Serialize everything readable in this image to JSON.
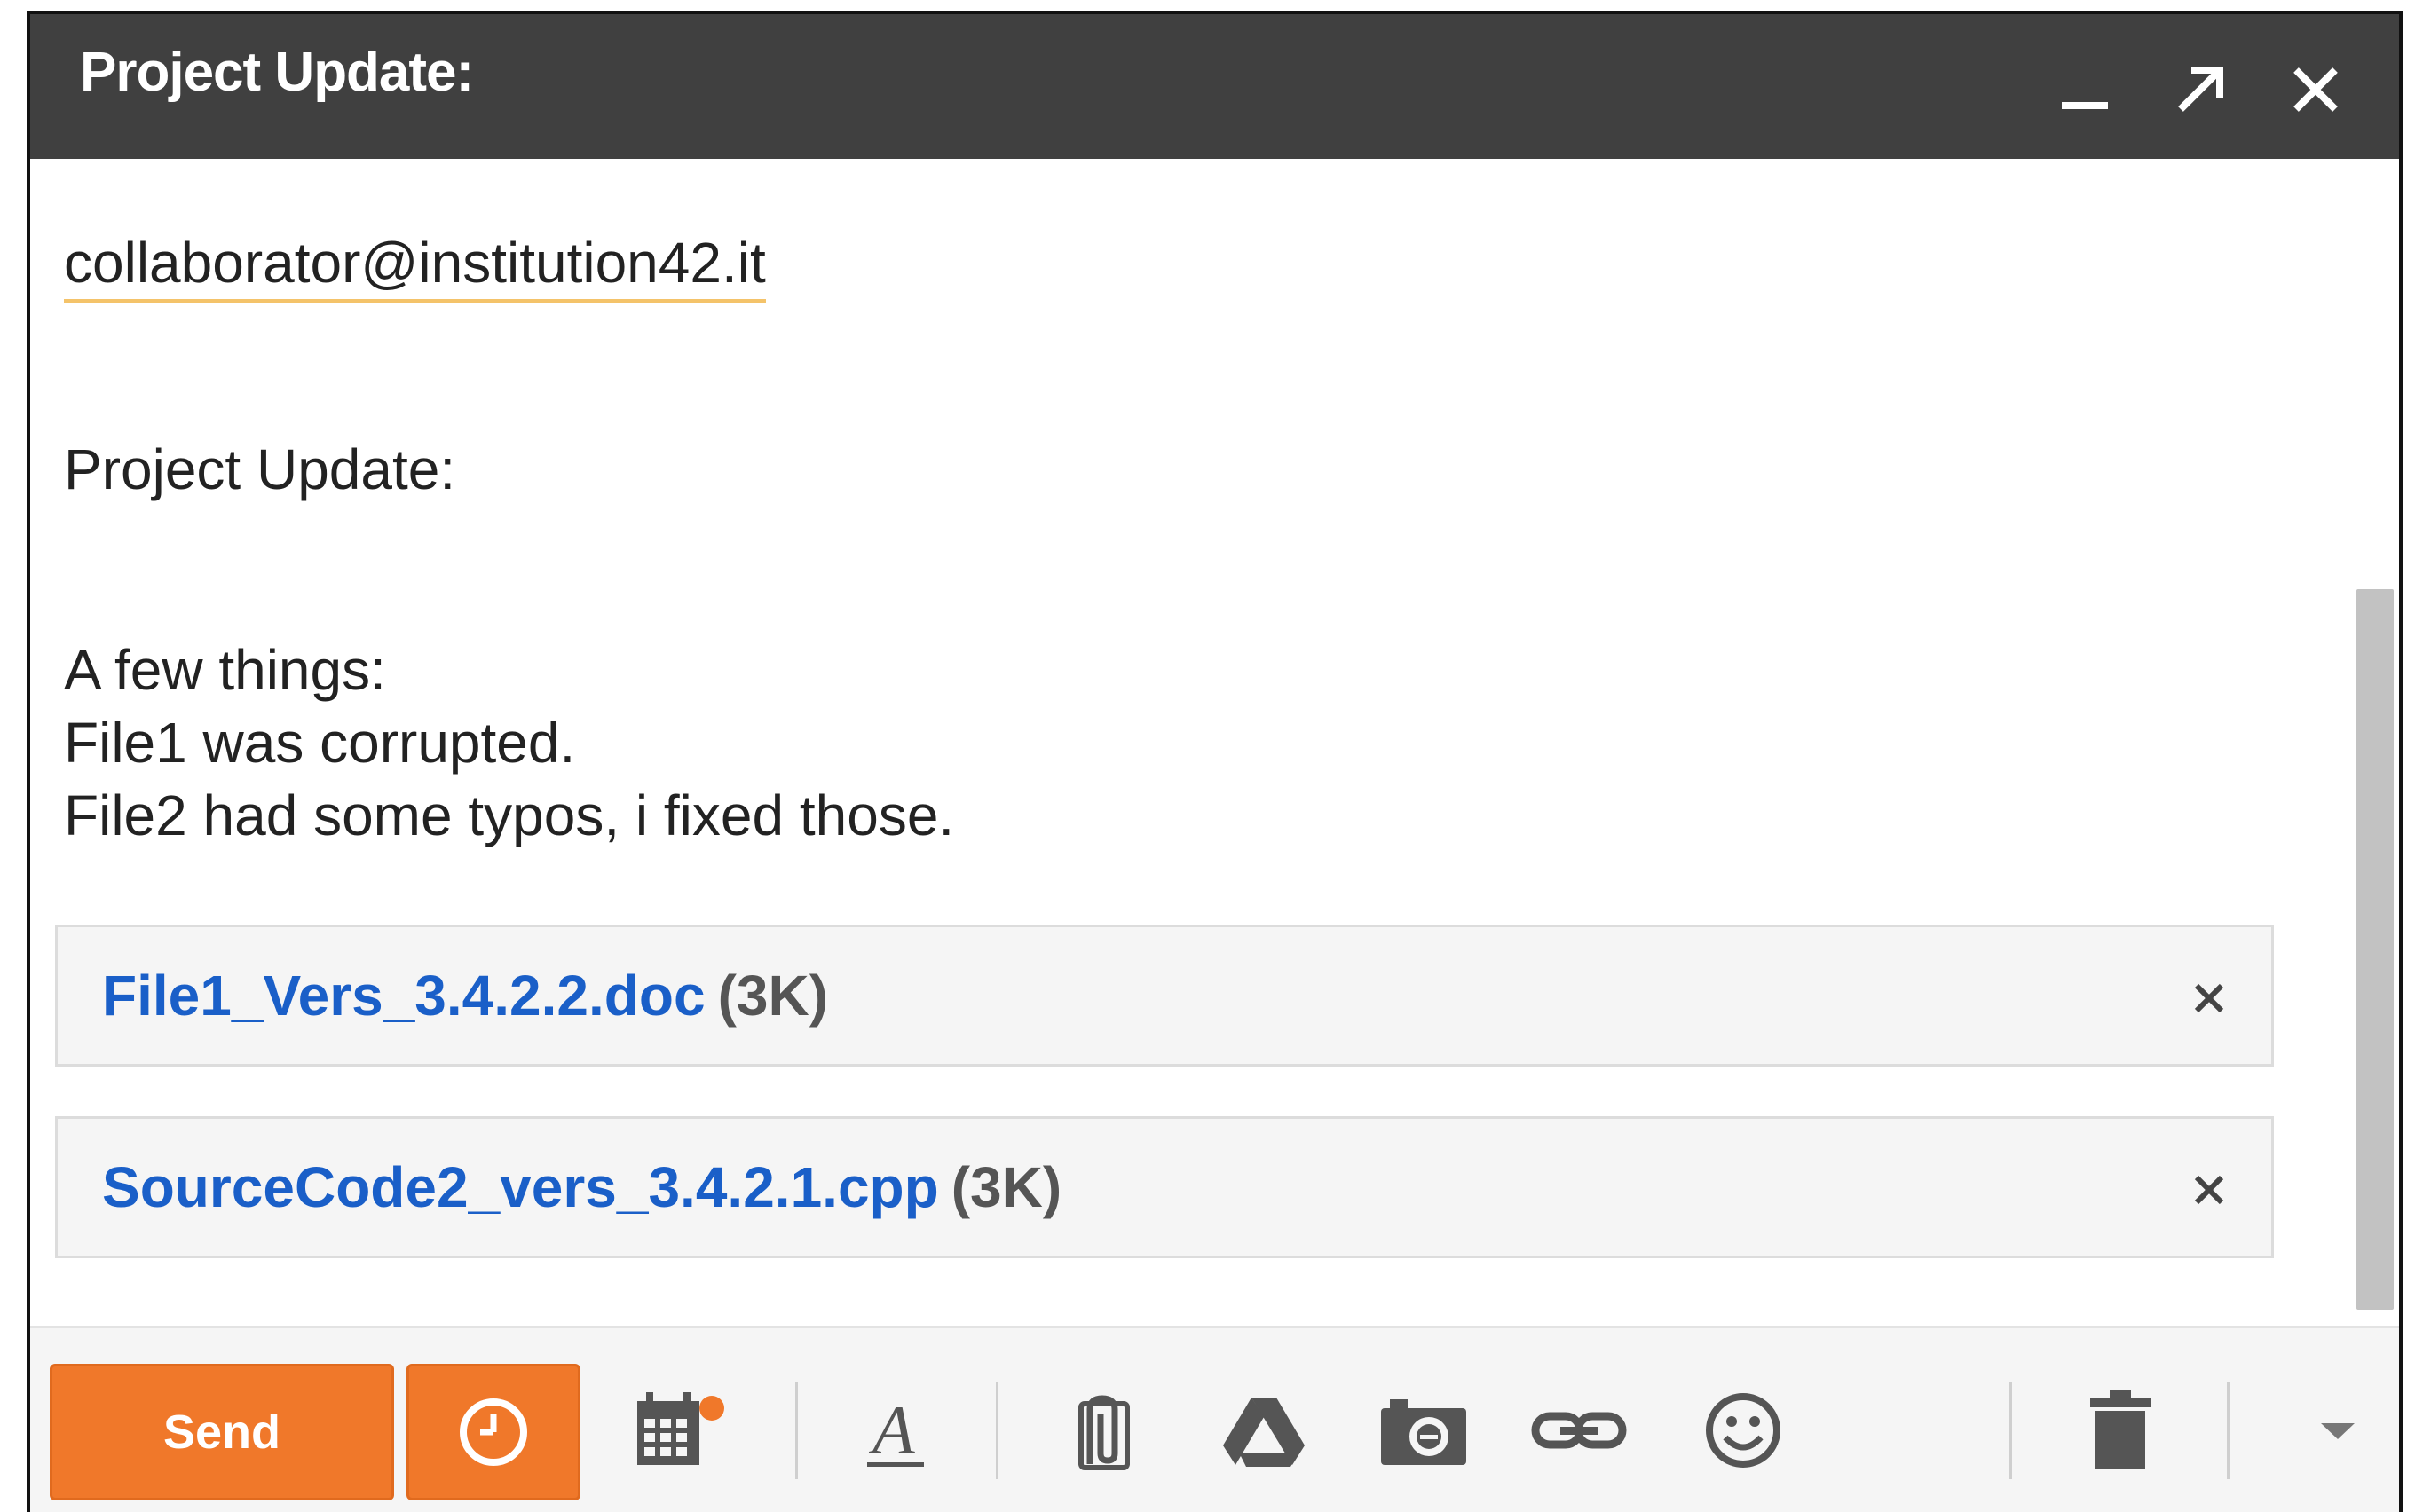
{
  "window": {
    "title": "Project Update:"
  },
  "to": {
    "recipient": "collaborator@institution42.it"
  },
  "subject": {
    "value": "Project Update:"
  },
  "body": {
    "lines": [
      "A few things:",
      "File1 was corrupted.",
      "File2 had some typos, i fixed those."
    ]
  },
  "attachments": [
    {
      "name": "File1_Vers_3.4.2.2.doc",
      "size": "(3K)"
    },
    {
      "name": "SourceCode2_vers_3.4.2.1.cpp",
      "size": "(3K)"
    }
  ],
  "toolbar": {
    "send_label": "Send",
    "accent_color": "#f0782a",
    "icons": [
      "schedule-send-clock-icon",
      "calendar-invite-icon",
      "formatting-icon",
      "attach-file-icon",
      "google-drive-icon",
      "insert-photo-icon",
      "insert-link-icon",
      "insert-emoji-icon",
      "discard-trash-icon",
      "more-options-icon"
    ]
  }
}
